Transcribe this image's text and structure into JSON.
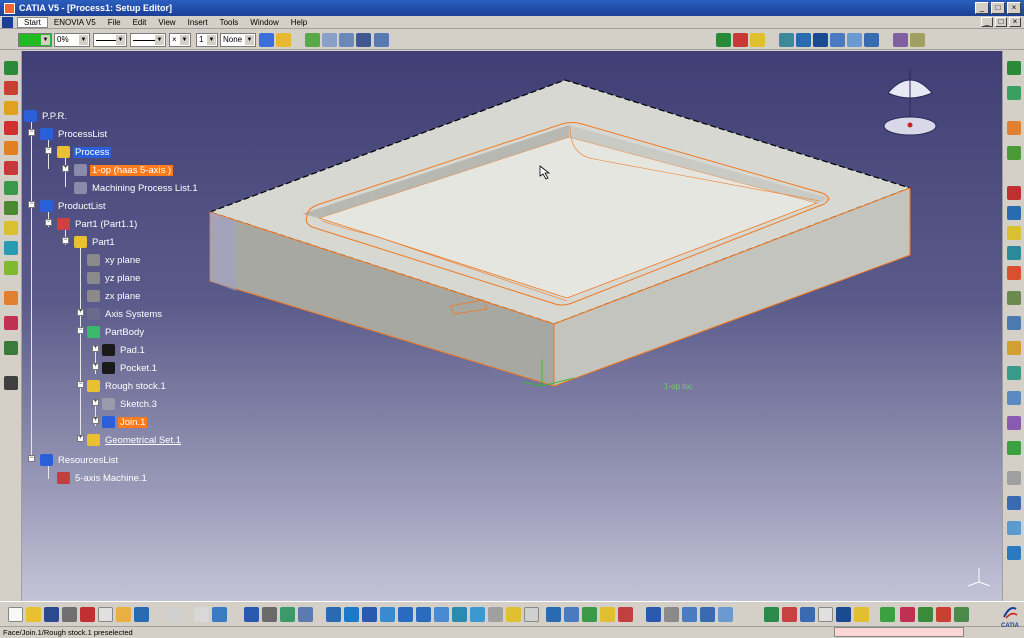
{
  "window": {
    "title": "CATIA V5 - [Process1: Setup Editor]"
  },
  "menu": {
    "items": [
      "Start",
      "ENOVIA V5",
      "File",
      "Edit",
      "View",
      "Insert",
      "Tools",
      "Window",
      "Help"
    ]
  },
  "toolbar": {
    "color_value": "",
    "transparency_value": "0%",
    "layer_value": "None",
    "layer_number": "1"
  },
  "tree": {
    "root": "P.P.R.",
    "process_list": "ProcessList",
    "process": "Process",
    "operation": "1-op (haas 5-axis )",
    "machining_process_list": "Machining Process List.1",
    "product_list": "ProductList",
    "part_instance": "Part1 (Part1.1)",
    "part": "Part1",
    "xy_plane": "xy plane",
    "yz_plane": "yz plane",
    "zx_plane": "zx plane",
    "axis_systems": "Axis Systems",
    "part_body": "PartBody",
    "pad": "Pad.1",
    "pocket": "Pocket.1",
    "rough_stock": "Rough stock.1",
    "sketch": "Sketch.3",
    "join": "Join.1",
    "geometrical_set": "Geometrical Set.1",
    "resources_list": "ResourcesList",
    "machine": "5-axis Machine.1"
  },
  "viewport": {
    "operation_label": "1-op toc"
  },
  "status": {
    "text": "Face/Join.1/Rough stock.1 preselected"
  },
  "logo": {
    "text": "CATIA"
  }
}
